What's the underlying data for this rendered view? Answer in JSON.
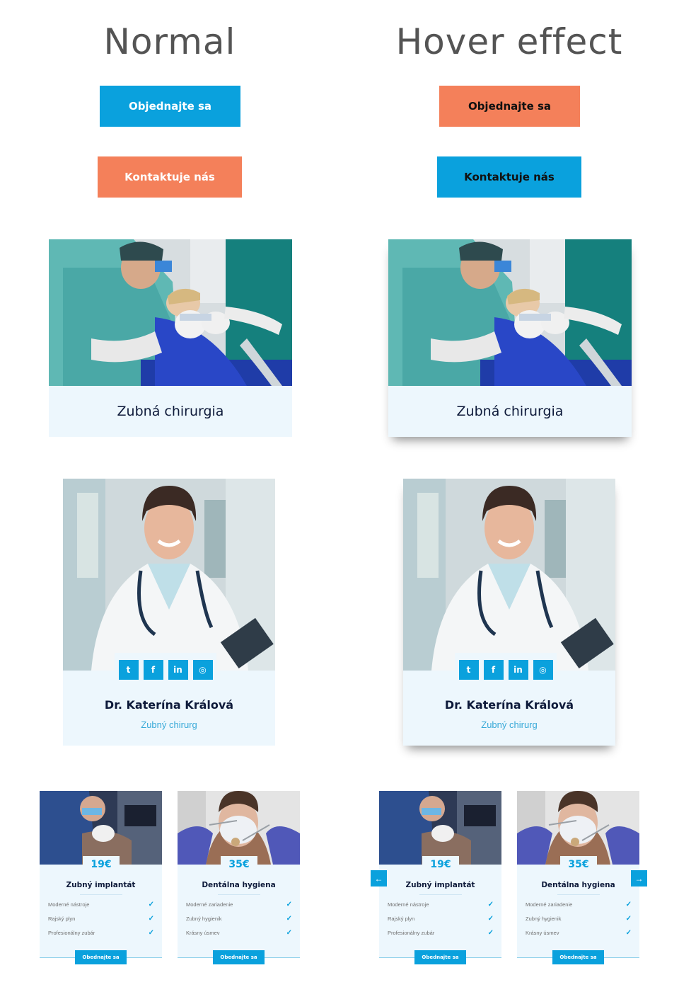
{
  "headings": {
    "normal": "Normal",
    "hover": "Hover effect"
  },
  "buttons": {
    "order": "Objednajte sa",
    "contact": "Kontaktuje nás"
  },
  "service": {
    "title": "Zubná chirurgia"
  },
  "team": {
    "name": "Dr. Katerína Králová",
    "role": "Zubný chirurg",
    "socials": [
      "twitter-icon",
      "facebook-icon",
      "linkedin-icon",
      "instagram-icon"
    ]
  },
  "pricing": [
    {
      "price": "19€",
      "title": "Zubný implantát",
      "features": [
        "Moderné nástroje",
        "Rajský plyn",
        "Profesionálny zubár"
      ],
      "button": "Obednajte sa"
    },
    {
      "price": "35€",
      "title": "Dentálna hygiena",
      "features": [
        "Moderné zariadenie",
        "Zubný hygienik",
        "Krásny úsmev"
      ],
      "button": "Obednajte sa"
    }
  ],
  "colors": {
    "blue": "#0aa1dd",
    "orange": "#f4805a",
    "card_bg": "#edf7fd",
    "text_dark": "#0e1a3a"
  }
}
